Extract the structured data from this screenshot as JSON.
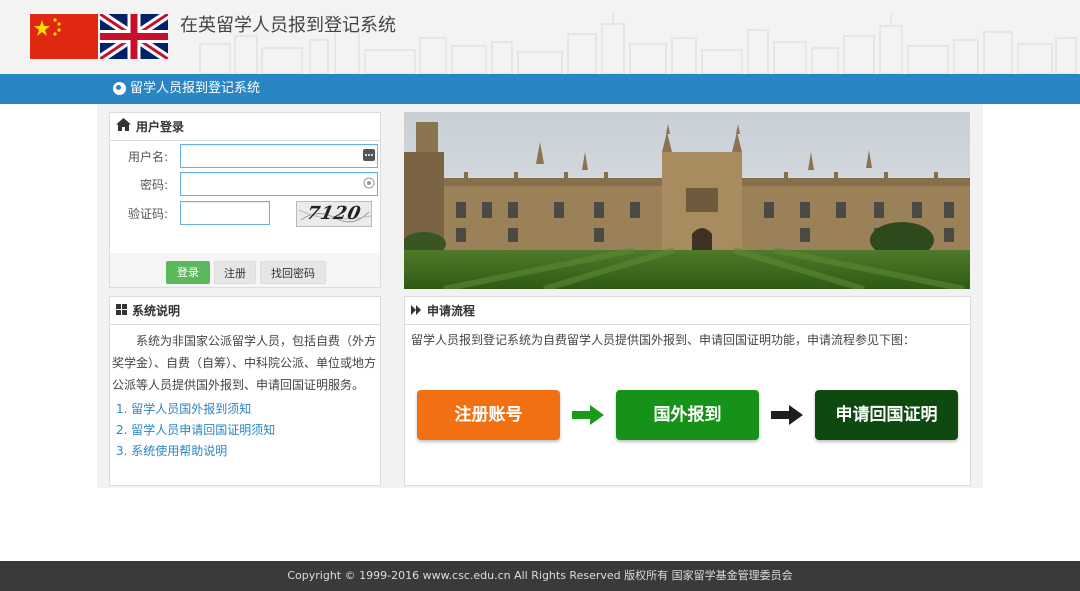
{
  "header": {
    "site_title": "在英留学人员报到登记系统",
    "flags": [
      "china-flag",
      "uk-flag"
    ]
  },
  "nav": {
    "title": "留学人员报到登记系统",
    "icon": "globe-icon"
  },
  "login": {
    "heading": "用户登录",
    "heading_icon": "home-icon",
    "username_label": "用户名:",
    "username_value": "",
    "password_label": "密码:",
    "password_value": "",
    "captcha_label": "验证码:",
    "captcha_value": "",
    "captcha_text": "7120",
    "login_button": "登录",
    "register_button": "注册",
    "recover_button": "找回密码"
  },
  "system_description": {
    "heading": "系统说明",
    "heading_icon": "windows-icon",
    "text": "系统为非国家公派留学人员，包括自费（外方奖学金）、自费（自筹）、中科院公派、单位或地方公派等人员提供国外报到、申请回国证明服务。",
    "links": [
      "1. 留学人员国外报到须知",
      "2. 留学人员申请回国证明须知",
      "3. 系统使用帮助说明"
    ]
  },
  "process": {
    "heading": "申请流程",
    "heading_icon": "double-chevron-right-icon",
    "text": "留学人员报到登记系统为自费留学人员提供国外报到、申请回国证明功能，申请流程参见下图：",
    "steps": [
      "注册账号",
      "国外报到",
      "申请回国证明"
    ],
    "colors": [
      "#f26f12",
      "#169218",
      "#0e4a10"
    ]
  },
  "footer": {
    "text": "Copyright © 1999-2016 www.csc.edu.cn All Rights Reserved  版权所有  国家留学基金管理委员会"
  }
}
